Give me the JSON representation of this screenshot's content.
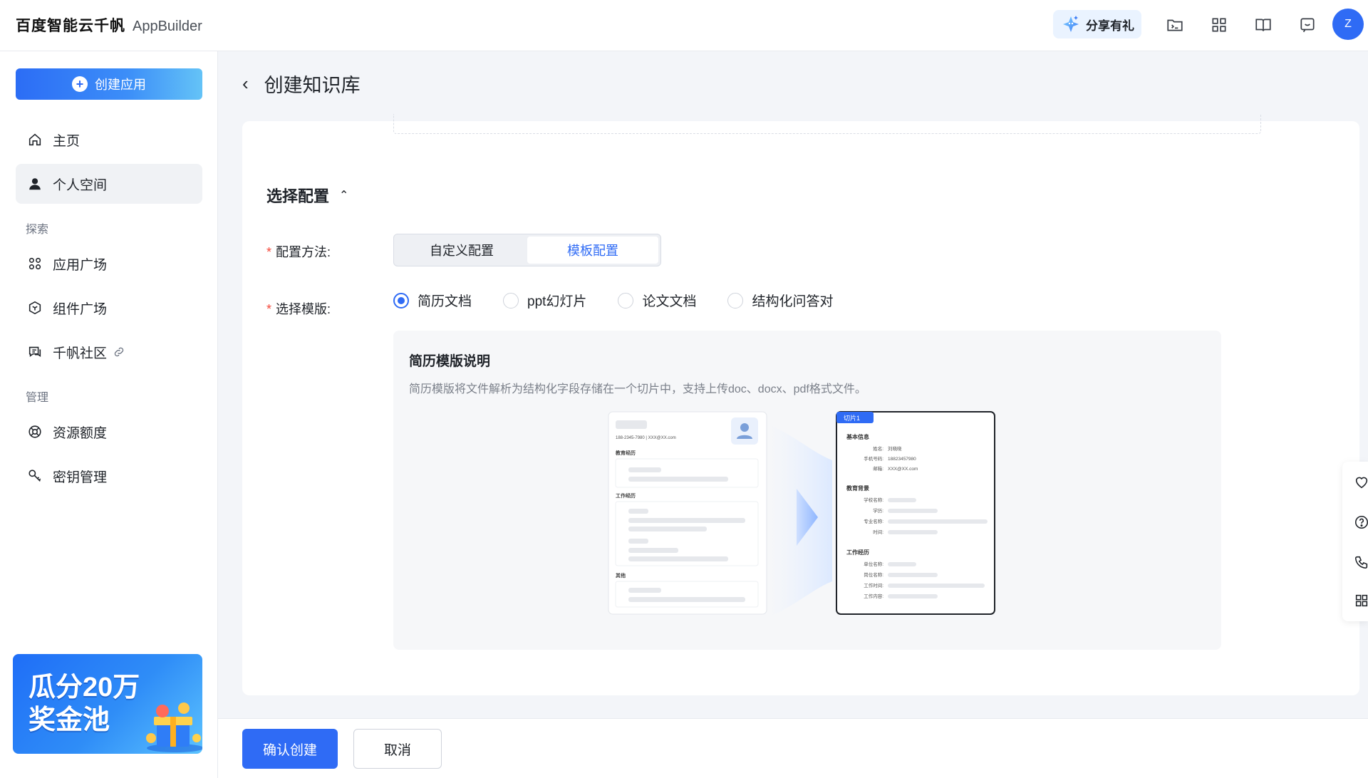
{
  "header": {
    "brand_cn": "百度智能云千帆",
    "brand_en": "AppBuilder",
    "share_label": "分享有礼",
    "icons": [
      "terminal-folder-icon",
      "apps-grid-icon",
      "book-icon",
      "chat-icon"
    ],
    "avatar_letter": "Z"
  },
  "sidebar": {
    "create_label": "创建应用",
    "items": [
      {
        "label": "主页",
        "icon": "home-icon"
      },
      {
        "label": "个人空间",
        "icon": "user-icon"
      }
    ],
    "section_explore": "探索",
    "explore_items": [
      {
        "label": "应用广场",
        "icon": "apps-icon"
      },
      {
        "label": "组件广场",
        "icon": "cube-icon"
      },
      {
        "label": "千帆社区",
        "icon": "community-icon"
      }
    ],
    "section_manage": "管理",
    "manage_items": [
      {
        "label": "资源额度",
        "icon": "lifebuoy-icon"
      },
      {
        "label": "密钥管理",
        "icon": "key-icon"
      }
    ],
    "promo_line1": "瓜分20万",
    "promo_line2": "奖金池"
  },
  "page": {
    "title": "创建知识库",
    "section_title": "选择配置",
    "config_label": "配置方法:",
    "config_options": [
      "自定义配置",
      "模板配置"
    ],
    "config_selected": "模板配置",
    "template_label": "选择模版:",
    "template_options": [
      "简历文档",
      "ppt幻灯片",
      "论文文档",
      "结构化问答对"
    ],
    "template_selected": "简历文档",
    "template_title": "简历模版说明",
    "template_desc": "简历模版将文件解析为结构化字段存储在一个切片中，支持上传doc、docx、pdf格式文件。",
    "illustration": {
      "resume_contact": "188-2345-7980 | XXX@XX.com",
      "resume_sections": [
        "教育经历",
        "工作经历",
        "其他"
      ],
      "chunk_tag": "切片1",
      "basic_info_title": "基本信息",
      "basic_info": [
        {
          "k": "姓名:",
          "v": "刘晓晓"
        },
        {
          "k": "手机号码:",
          "v": "18823457980"
        },
        {
          "k": "邮箱:",
          "v": "XXX@XX.com"
        }
      ],
      "edu_title": "教育背景",
      "edu_fields": [
        "学校名称:",
        "学历:",
        "专业名称:",
        "时间:"
      ],
      "work_title": "工作经历",
      "work_fields": [
        "单位名称:",
        "岗位名称:",
        "工作时间:",
        "工作内容:"
      ]
    }
  },
  "footer": {
    "confirm_label": "确认创建",
    "cancel_label": "取消"
  },
  "float_tools": [
    "heart-icon",
    "help-icon",
    "phone-icon",
    "grid-icon"
  ],
  "colors": {
    "primary": "#2f6bf5",
    "required": "#f5483b",
    "page_bg": "#f3f5f9"
  }
}
